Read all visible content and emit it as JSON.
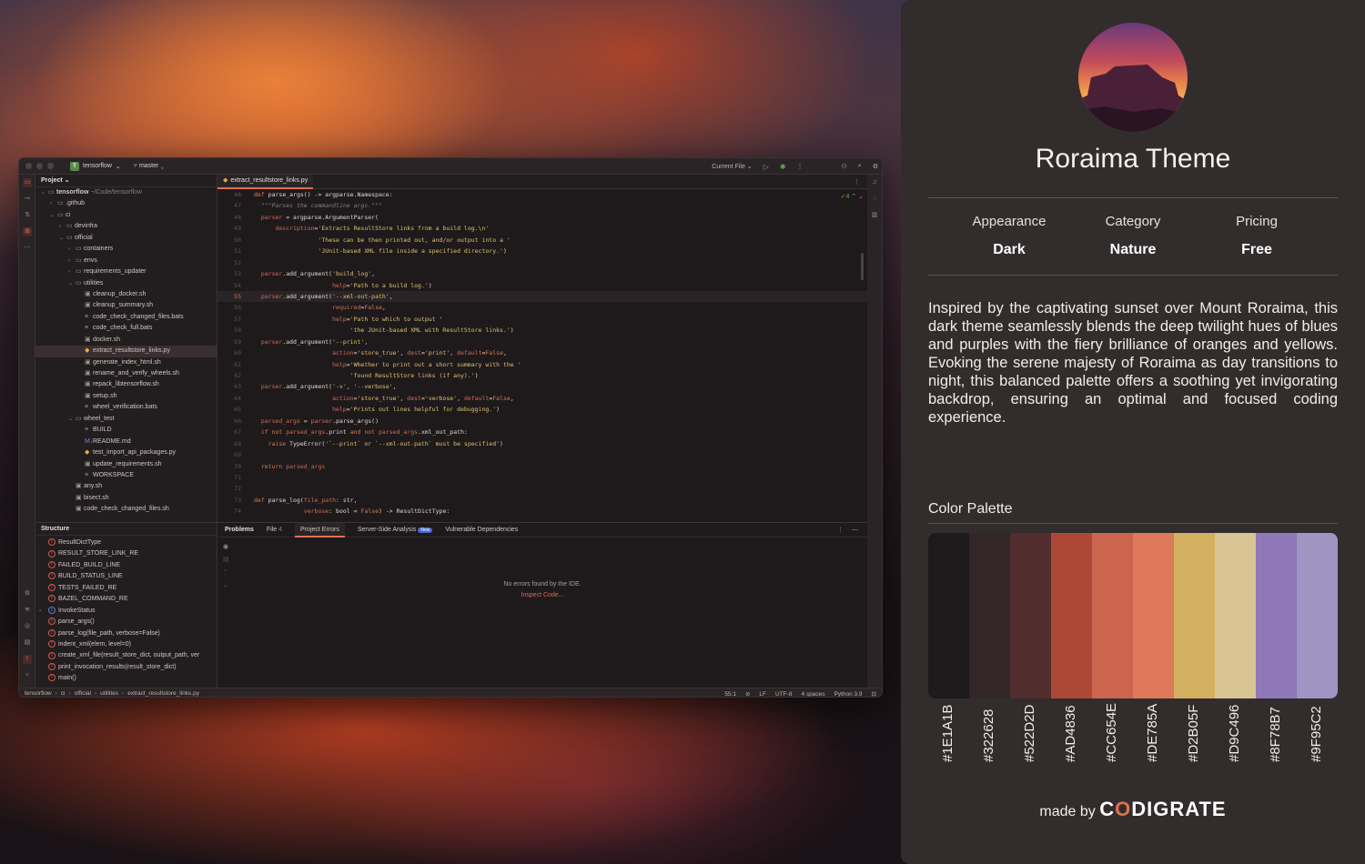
{
  "ide": {
    "project_badge": "T",
    "project_name": "tensorflow",
    "branch": "master",
    "run_config": "Current File",
    "project_pane_title": "Project",
    "active_tab": "extract_resultstore_links.py",
    "inspection_count": "4",
    "tree": [
      {
        "chev": "⌄",
        "icon": "▭",
        "name": "tensorflow",
        "extra": "~/Code/tensorflow",
        "indent": 0,
        "bold": true
      },
      {
        "chev": "›",
        "icon": "▭",
        "name": ".github",
        "extra": "",
        "indent": 1
      },
      {
        "chev": "⌄",
        "icon": "▭",
        "name": "ci",
        "extra": "",
        "indent": 1
      },
      {
        "chev": "›",
        "icon": "▭",
        "name": "devinfra",
        "extra": "",
        "indent": 2
      },
      {
        "chev": "⌄",
        "icon": "▭",
        "name": "official",
        "extra": "",
        "indent": 2
      },
      {
        "chev": "›",
        "icon": "▭",
        "name": "containers",
        "extra": "",
        "indent": 3
      },
      {
        "chev": "›",
        "icon": "▭",
        "name": "envs",
        "extra": "",
        "indent": 3
      },
      {
        "chev": "›",
        "icon": "▭",
        "name": "requirements_updater",
        "extra": "",
        "indent": 3
      },
      {
        "chev": "⌄",
        "icon": "▭",
        "name": "utilities",
        "extra": "",
        "indent": 3
      },
      {
        "chev": "",
        "icon": "▣",
        "name": "cleanup_docker.sh",
        "extra": "",
        "indent": 4
      },
      {
        "chev": "",
        "icon": "▣",
        "name": "cleanup_summary.sh",
        "extra": "",
        "indent": 4
      },
      {
        "chev": "",
        "icon": "≡",
        "name": "code_check_changed_files.bats",
        "extra": "",
        "indent": 4
      },
      {
        "chev": "",
        "icon": "≡",
        "name": "code_check_full.bats",
        "extra": "",
        "indent": 4
      },
      {
        "chev": "",
        "icon": "▣",
        "name": "docker.sh",
        "extra": "",
        "indent": 4
      },
      {
        "chev": "",
        "icon": "◆",
        "name": "extract_resultstore_links.py",
        "extra": "",
        "indent": 4,
        "py": true,
        "sel": true
      },
      {
        "chev": "",
        "icon": "▣",
        "name": "generate_index_html.sh",
        "extra": "",
        "indent": 4
      },
      {
        "chev": "",
        "icon": "▣",
        "name": "rename_and_verify_wheels.sh",
        "extra": "",
        "indent": 4
      },
      {
        "chev": "",
        "icon": "▣",
        "name": "repack_libtensorflow.sh",
        "extra": "",
        "indent": 4
      },
      {
        "chev": "",
        "icon": "▣",
        "name": "setup.sh",
        "extra": "",
        "indent": 4
      },
      {
        "chev": "",
        "icon": "≡",
        "name": "wheel_verification.bats",
        "extra": "",
        "indent": 4
      },
      {
        "chev": "⌄",
        "icon": "▭",
        "name": "wheel_test",
        "extra": "",
        "indent": 3
      },
      {
        "chev": "",
        "icon": "≡",
        "name": "BUILD",
        "extra": "",
        "indent": 4
      },
      {
        "chev": "",
        "icon": "M↓",
        "name": "README.md",
        "extra": "",
        "indent": 4,
        "md": true
      },
      {
        "chev": "",
        "icon": "◆",
        "name": "test_import_api_packages.py",
        "extra": "",
        "indent": 4,
        "py": true
      },
      {
        "chev": "",
        "icon": "▣",
        "name": "update_requirements.sh",
        "extra": "",
        "indent": 4
      },
      {
        "chev": "",
        "icon": "≡",
        "name": "WORKSPACE",
        "extra": "",
        "indent": 4
      },
      {
        "chev": "",
        "icon": "▣",
        "name": "any.sh",
        "extra": "",
        "indent": 3
      },
      {
        "chev": "",
        "icon": "▣",
        "name": "bisect.sh",
        "extra": "",
        "indent": 3
      },
      {
        "chev": "",
        "icon": "▣",
        "name": "code_check_changed_files.sh",
        "extra": "",
        "indent": 3
      }
    ],
    "code": [
      {
        "n": "46",
        "html": "<span class='kw'>def</span> parse_args() -> argparse.Namespace:"
      },
      {
        "n": "47",
        "html": "  <span class='cm'>\"\"\"Parses the commandline args.\"\"\"</span>"
      },
      {
        "n": "48",
        "html": "  <span class='pm'>parser</span> = argparse.ArgumentParser("
      },
      {
        "n": "49",
        "html": "      <span class='pm'>description</span>=<span class='st'>'Extracts ResultStore links from a build log.\\n'</span>"
      },
      {
        "n": "50",
        "html": "                  <span class='st'>'These can be then printed out, and/or output into a '</span>"
      },
      {
        "n": "51",
        "html": "                  <span class='st'>'JUnit-based XML file inside a specified directory.'</span>)"
      },
      {
        "n": "52",
        "html": ""
      },
      {
        "n": "53",
        "html": "  <span class='pm'>parser</span>.add_argument(<span class='st'>'build_log'</span>,"
      },
      {
        "n": "54",
        "html": "                      <span class='pm'>help</span>=<span class='st'>'Path to a build log.'</span>)"
      },
      {
        "n": "55",
        "html": "  <span class='pm'>parser</span>.add_argument(<span class='st'>'--xml-out-path'</span>,",
        "cur": true
      },
      {
        "n": "56",
        "html": "                      <span class='pm'>required</span>=<span class='kw'>False</span>,"
      },
      {
        "n": "57",
        "html": "                      <span class='pm'>help</span>=<span class='st'>'Path to which to output '</span>"
      },
      {
        "n": "58",
        "html": "                           <span class='st'>'the JUnit-based XML with ResultStore links.'</span>)"
      },
      {
        "n": "59",
        "html": "  <span class='pm'>parser</span>.add_argument(<span class='st'>'--print'</span>,"
      },
      {
        "n": "60",
        "html": "                      <span class='pm'>action</span>=<span class='st'>'store_true'</span>, <span class='pm'>dest</span>=<span class='st'>'print'</span>, <span class='pm'>default</span>=<span class='kw'>False</span>,"
      },
      {
        "n": "61",
        "html": "                      <span class='pm'>help</span>=<span class='st'>'Whether to print out a short summary with the '</span>"
      },
      {
        "n": "62",
        "html": "                           <span class='st'>'found ResultStore links (if any).'</span>)"
      },
      {
        "n": "63",
        "html": "  <span class='pm'>parser</span>.add_argument(<span class='st'>'-v'</span>, <span class='st'>'--verbose'</span>,"
      },
      {
        "n": "64",
        "html": "                      <span class='pm'>action</span>=<span class='st'>'store_true'</span>, <span class='pm'>dest</span>=<span class='st'>'verbose'</span>, <span class='pm'>default</span>=<span class='kw'>False</span>,"
      },
      {
        "n": "65",
        "html": "                      <span class='pm'>help</span>=<span class='st'>'Prints out lines helpful for debugging.'</span>)"
      },
      {
        "n": "66",
        "html": "  <span class='pm'>parsed_args</span> = <span class='pm'>parser</span>.parse_args()"
      },
      {
        "n": "67",
        "html": "  <span class='kw'>if not</span> <span class='pm'>parsed_args</span>.print <span class='kw'>and not</span> <span class='pm'>parsed_args</span>.xml_out_path:"
      },
      {
        "n": "68",
        "html": "    <span class='kw'>raise</span> TypeError(<span class='st'>'`--print` or `--xml-out-path` must be specified'</span>)"
      },
      {
        "n": "69",
        "html": ""
      },
      {
        "n": "70",
        "html": "  <span class='kw'>return</span> <span class='pm'>parsed_args</span>"
      },
      {
        "n": "71",
        "html": ""
      },
      {
        "n": "72",
        "html": ""
      },
      {
        "n": "73",
        "html": "<span class='kw'>def</span> parse_log(<span class='pm'>file_path</span>: str,"
      },
      {
        "n": "74",
        "html": "              <span class='pm'>verbose</span>: bool = <span class='kw'>False</span>) -> ResultDictType:"
      }
    ],
    "structure_title": "Structure",
    "structure": [
      {
        "icon": "f",
        "name": "ResultDictType"
      },
      {
        "icon": "f",
        "name": "RESULT_STORE_LINK_RE"
      },
      {
        "icon": "f",
        "name": "FAILED_BUILD_LINE"
      },
      {
        "icon": "f",
        "name": "BUILD_STATUS_LINE"
      },
      {
        "icon": "f",
        "name": "TESTS_FAILED_RE"
      },
      {
        "icon": "f",
        "name": "BAZEL_COMMAND_RE"
      },
      {
        "icon": "c",
        "name": "InvokeStatus",
        "chev": true
      },
      {
        "icon": "f",
        "name": "parse_args()"
      },
      {
        "icon": "f",
        "name": "parse_log(file_path, verbose=False)"
      },
      {
        "icon": "f",
        "name": "indent_xml(elem, level=0)"
      },
      {
        "icon": "f",
        "name": "create_xml_file(result_store_dict, output_path, ver"
      },
      {
        "icon": "f",
        "name": "print_invocation_results(result_store_dict)"
      },
      {
        "icon": "f",
        "name": "main()"
      }
    ],
    "problems": {
      "title": "Problems",
      "file_tab": "File",
      "file_count": "4",
      "project_errors": "Project Errors",
      "server_side": "Server-Side Analysis",
      "new_badge": "New",
      "vulnerable": "Vulnerable Dependencies",
      "empty_message": "No errors found by the IDE.",
      "inspect_link": "Inspect Code..."
    },
    "breadcrumb": [
      "tensorflow",
      "ci",
      "official",
      "utilities",
      "extract_resultstore_links.py"
    ],
    "status": {
      "position": "55:1",
      "line_sep": "LF",
      "encoding": "UTF-8",
      "indent": "4 spaces",
      "interpreter": "Python 3.9"
    }
  },
  "theme": {
    "title": "Roraima Theme",
    "meta": [
      {
        "label": "Appearance",
        "value": "Dark"
      },
      {
        "label": "Category",
        "value": "Nature"
      },
      {
        "label": "Pricing",
        "value": "Free"
      }
    ],
    "description": "Inspired by the captivating sunset over Mount Roraima, this dark theme seamlessly blends the deep twilight hues of blues and purples with the fiery brilliance of oranges and yellows. Evoking the serene majesty of Roraima as day transitions to night, this balanced palette offers a soothing yet invigorating backdrop, ensuring an optimal and focused coding experience.",
    "palette_title": "Color Palette",
    "palette": [
      "#1E1A1B",
      "#322628",
      "#522D2D",
      "#AD4836",
      "#CC654E",
      "#DE785A",
      "#D2B05F",
      "#D9C496",
      "#8F78B7",
      "#9F95C2"
    ],
    "made_by": "made by",
    "brand": "CODIGRATE"
  }
}
